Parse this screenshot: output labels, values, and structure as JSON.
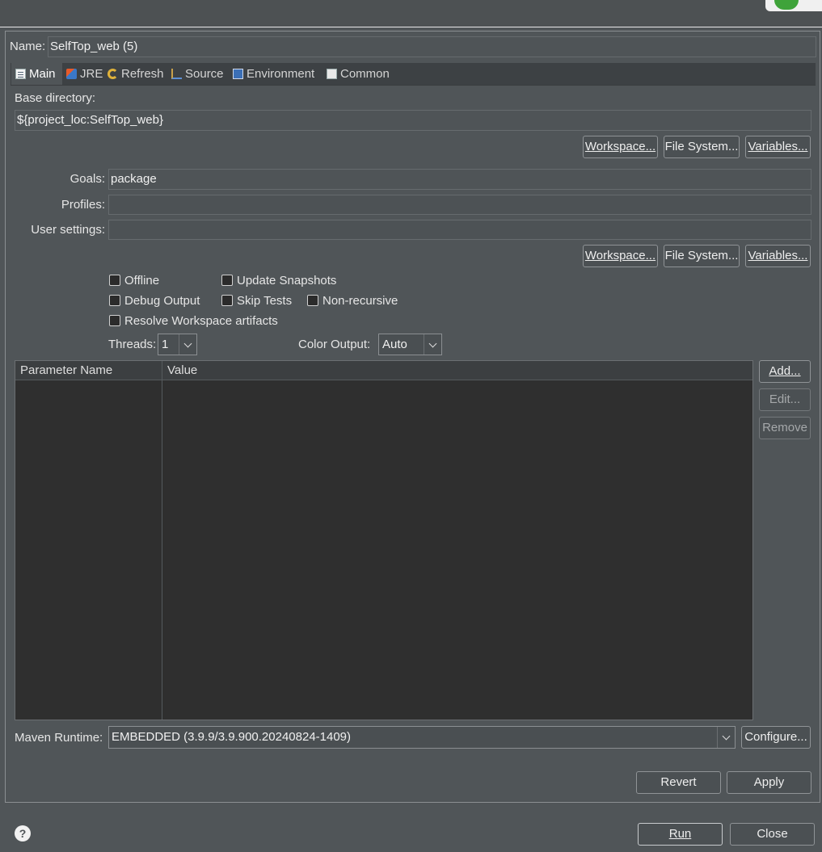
{
  "name": {
    "label": "Name:",
    "value": "SelfTop_web (5)"
  },
  "tabs": [
    {
      "label": "Main",
      "icon": "main-tab-icon",
      "active": true
    },
    {
      "label": "JRE",
      "icon": "jre-icon"
    },
    {
      "label": "Refresh",
      "icon": "refresh-icon"
    },
    {
      "label": "Source",
      "icon": "source-icon"
    },
    {
      "label": "Environment",
      "icon": "environment-icon"
    },
    {
      "label": "Common",
      "icon": "common-icon"
    }
  ],
  "base_directory": {
    "label": "Base directory:",
    "value": "${project_loc:SelfTop_web}"
  },
  "dir_buttons": {
    "workspace": "Workspace...",
    "file_system": "File System...",
    "variables": "Variables..."
  },
  "goals": {
    "label": "Goals:",
    "value": "package"
  },
  "profiles": {
    "label": "Profiles:",
    "value": ""
  },
  "user_settings": {
    "label": "User settings:",
    "value": ""
  },
  "settings_buttons": {
    "workspace": "Workspace...",
    "file_system": "File System...",
    "variables": "Variables..."
  },
  "options": {
    "offline": "Offline",
    "update_snapshots": "Update Snapshots",
    "debug_output": "Debug Output",
    "skip_tests": "Skip Tests",
    "non_recursive": "Non-recursive",
    "resolve_workspace": "Resolve Workspace artifacts"
  },
  "threads": {
    "label": "Threads:",
    "value": "1"
  },
  "color_output": {
    "label": "Color Output:",
    "value": "Auto"
  },
  "parameters": {
    "columns": [
      "Parameter Name",
      "Value"
    ],
    "rows": [],
    "add": "Add...",
    "edit": "Edit...",
    "remove": "Remove"
  },
  "maven_runtime": {
    "label": "Maven Runtime:",
    "value": "EMBEDDED (3.9.9/3.9.900.20240824-1409)",
    "configure": "Configure..."
  },
  "footer": {
    "revert": "Revert",
    "apply": "Apply",
    "run": "Run",
    "close": "Close",
    "help": "?"
  }
}
